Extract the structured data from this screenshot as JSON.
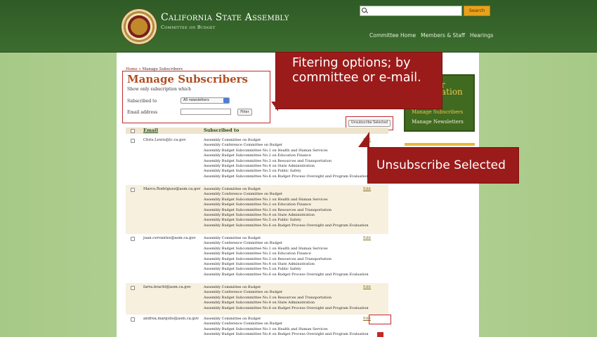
{
  "header": {
    "title": "California State Assembly",
    "subtitle": "Committee on Budget",
    "search": {
      "placeholder": "",
      "button_label": "Search"
    },
    "nav": [
      {
        "label": "Committee Home"
      },
      {
        "label": "Members & Staff"
      },
      {
        "label": "Hearings"
      }
    ]
  },
  "breadcrumb": {
    "home": "Home",
    "separator": " » ",
    "current": "Manage Subscribers"
  },
  "main": {
    "title": "Manage Subscribers",
    "show_only_label": "Show only subscription which",
    "subscribed_to_label": "Subscribed to",
    "subscribed_to_value": "All newsletters",
    "email_label": "Email address",
    "email_value": "",
    "filter_button": "Filter",
    "unsubscribe_button": "Unsubscribe Selected",
    "columns": {
      "email": "Email",
      "subscribed": "Subscribed to"
    },
    "rows": [
      {
        "email": "Chris.Lewis@lc.ca.gov",
        "edit": "Edit",
        "subscriptions": [
          "Assembly Committee on Budget",
          "Assembly Conference Committee on Budget",
          "Assembly Budget Subcommittee No.1 on Health and Human Services",
          "Assembly Budget Subcommittee No.2 on Education Finance",
          "Assembly Budget Subcommittee No.3 on Resources and Transportation",
          "Assembly Budget Subcommittee No.4 on State Administration",
          "Assembly Budget Subcommittee No.5 on Public Safety",
          "Assembly Budget Subcommittee No.6 on Budget Process Oversight and Program Evaluation"
        ]
      },
      {
        "email": "Marco.Rodriguez@asm.ca.gov",
        "edit": "Edit",
        "subscriptions": [
          "Assembly Committee on Budget",
          "Assembly Conference Committee on Budget",
          "Assembly Budget Subcommittee No.1 on Health and Human Services",
          "Assembly Budget Subcommittee No.2 on Education Finance",
          "Assembly Budget Subcommittee No.3 on Resources and Transportation",
          "Assembly Budget Subcommittee No.4 on State Administration",
          "Assembly Budget Subcommittee No.5 on Public Safety",
          "Assembly Budget Subcommittee No.6 on Budget Process Oversight and Program Evaluation"
        ]
      },
      {
        "email": "juan.cervantes@asm.ca.gov",
        "edit": "Edit",
        "subscriptions": [
          "Assembly Committee on Budget",
          "Assembly Conference Committee on Budget",
          "Assembly Budget Subcommittee No.1 on Health and Human Services",
          "Assembly Budget Subcommittee No.2 on Education Finance",
          "Assembly Budget Subcommittee No.3 on Resources and Transportation",
          "Assembly Budget Subcommittee No.4 on State Administration",
          "Assembly Budget Subcommittee No.5 on Public Safety",
          "Assembly Budget Subcommittee No.6 on Budget Process Oversight and Program Evaluation"
        ]
      },
      {
        "email": "farra.bracht@asm.ca.gov",
        "edit": "Edit",
        "subscriptions": [
          "Assembly Committee on Budget",
          "Assembly Conference Committee on Budget",
          "Assembly Budget Subcommittee No.3 on Resources and Transportation",
          "Assembly Budget Subcommittee No.4 on State Administration",
          "Assembly Budget Subcommittee No.6 on Budget Process Oversight and Program Evaluation"
        ]
      },
      {
        "email": "andrea.margolis@asm.ca.gov",
        "edit": "Edit",
        "subscriptions": [
          "Assembly Committee on Budget",
          "Assembly Conference Committee on Budget",
          "Assembly Budget Subcommittee No.1 on Health and Human Services",
          "Assembly Budget Subcommittee No.6 on Budget Process Oversight and Program Evaluation"
        ]
      }
    ]
  },
  "sidebar": {
    "title_line1": "r",
    "title_line2": "ation",
    "partial_link": "er",
    "links": [
      {
        "label": "Manage Subscribers"
      },
      {
        "label": "Manage Newsletters"
      }
    ]
  },
  "callouts": {
    "filter": "Fitering options; by committee or e-mail.",
    "unsubscribe": "Unsubscribe Selected"
  },
  "colors": {
    "header_green": "#2f5b26",
    "accent_red": "#9b1b1b",
    "title_orange": "#b04e22",
    "sidebar_gold": "#f2c64e"
  }
}
